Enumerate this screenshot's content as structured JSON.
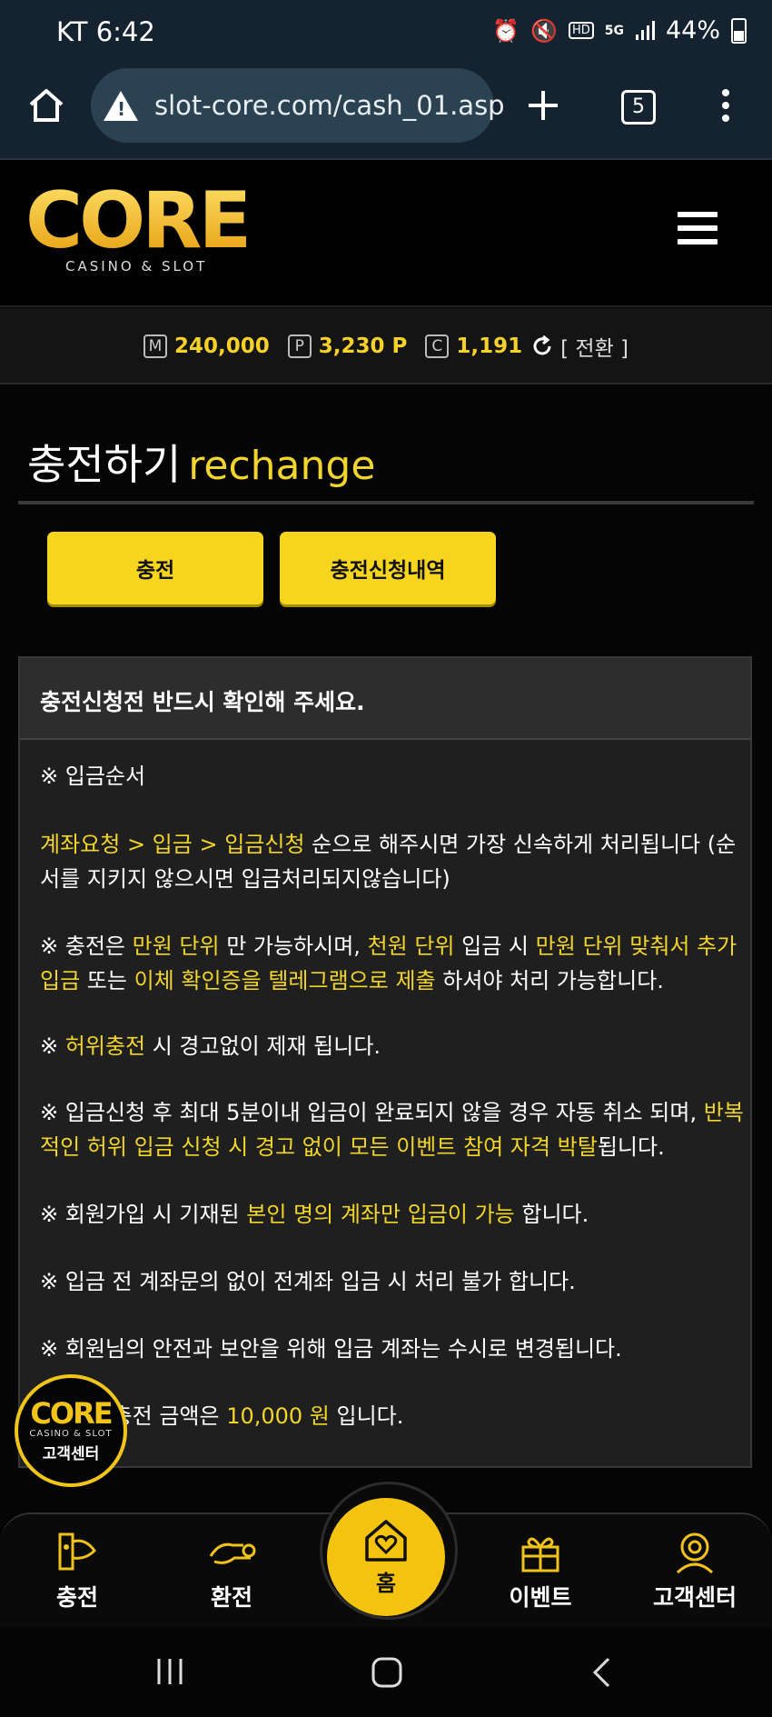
{
  "status_bar": {
    "carrier_time": "KT 6:42",
    "hd_label": "HD",
    "network_label": "5G",
    "battery": "44%"
  },
  "browser": {
    "url": "slot-core.com/cash_01.asp",
    "tab_count": "5"
  },
  "site": {
    "logo_text": "CORE",
    "logo_sub": "CASINO & SLOT",
    "accent_color": "#f1d42c"
  },
  "balance": {
    "money_icon": "M",
    "money": "240,000",
    "point_icon": "P",
    "points": "3,230 P",
    "coin_icon": "C",
    "coins": "1,191",
    "convert_label": "[ 전환 ]"
  },
  "page": {
    "title_kr": "충전하기",
    "title_en": "rechange",
    "buttons": {
      "charge": "충전",
      "history": "충전신청내역"
    }
  },
  "notice": {
    "header": "충전신청전 반드시 확인해 주세요.",
    "order_title": "※ 입금순서",
    "order_hl": "계좌요청 > 입금 > 입금신청",
    "order_rest": " 순으로 해주시면 가장 신속하게 처리됩니다 (순서를 지키지 않으시면 입금처리되지않습니다)",
    "p2": {
      "a": "※ 충전은 ",
      "b": "만원 단위",
      "c": " 만 가능하시며, ",
      "d": "천원 단위",
      "e": " 입금 시 ",
      "f": "만원 단위 맞춰서 추가입금",
      "g": " 또는 ",
      "h": "이체 확인증을 텔레그램으로 제출",
      "i": " 하셔야 처리 가능합니다."
    },
    "p3": {
      "a": "※ ",
      "b": "허위충전",
      "c": " 시 경고없이 제재 됩니다."
    },
    "p4": {
      "a": "※ 입금신청 후 최대 5분이내 입금이 완료되지 않을 경우 자동 취소 되며, ",
      "b": "반복적인 허위 입금 신청 시 경고 없이 모든 이벤트 참여 자격 박탈",
      "c": "됩니다."
    },
    "p5": {
      "a": "※ 회원가입 시 기재된 ",
      "b": "본인 명의 계좌만 입금이 가능",
      "c": " 합니다."
    },
    "p6": "※ 입금 전 계좌문의 없이 전계좌 입금 시 처리 불가 합니다.",
    "p7": "※ 회원님의 안전과 보안을 위해 입금 계좌는 수시로 변경됩니다.",
    "p8": {
      "a": "※ 최소 충전 금액은 ",
      "b": "10,000 원",
      "c": " 입니다."
    }
  },
  "support_float": {
    "logo": "CORE",
    "sub": "CASINO & SLOT",
    "label": "고객센터"
  },
  "bottom_nav": {
    "charge": "충전",
    "exchange": "환전",
    "home": "홈",
    "event": "이벤트",
    "support": "고객센터"
  }
}
